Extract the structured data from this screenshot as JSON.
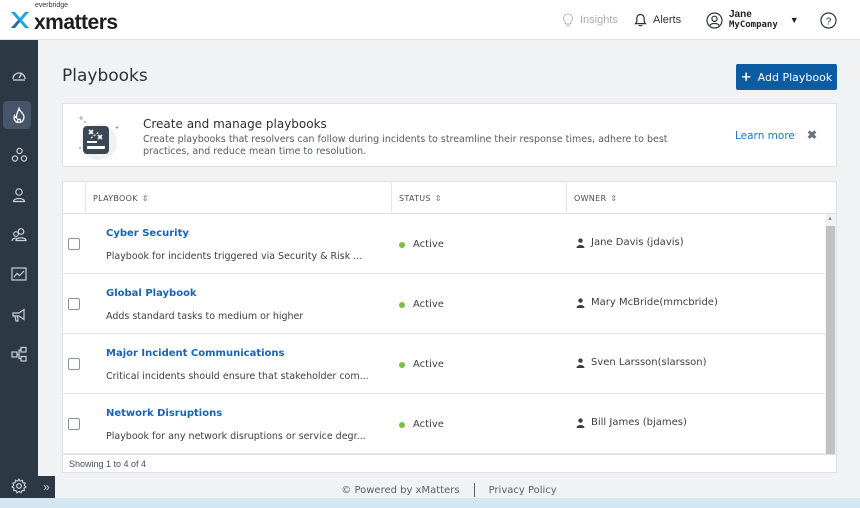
{
  "brand": {
    "small": "everbridge",
    "name": "xmatters",
    "mark_color": "#20a4dd"
  },
  "header": {
    "insights_label": "Insights",
    "alerts_label": "Alerts",
    "user_name": "Jane",
    "user_company": "MyCompany",
    "help_label": "?"
  },
  "sidebar": {
    "items": [
      {
        "icon": "dashboard-icon"
      },
      {
        "icon": "flame-icon",
        "active": true
      },
      {
        "icon": "groups-icon"
      },
      {
        "icon": "user-icon"
      },
      {
        "icon": "users-icon"
      },
      {
        "icon": "reports-icon"
      },
      {
        "icon": "megaphone-icon"
      },
      {
        "icon": "workflows-icon"
      }
    ],
    "settings_icon": "gear-icon",
    "expand_label": "»"
  },
  "page": {
    "title": "Playbooks",
    "add_button_label": "Add Playbook",
    "add_button_plus": "+"
  },
  "banner": {
    "title": "Create and manage playbooks",
    "description": "Create playbooks that resolvers can follow during incidents to streamline their response times, adhere to best practices, and reduce mean time to resolution.",
    "learn_more": "Learn more",
    "close": "✖"
  },
  "table": {
    "columns": {
      "playbook": "PLAYBOOK",
      "status": "STATUS",
      "owner": "OWNER",
      "sort": "⇕"
    },
    "rows": [
      {
        "name": "Cyber Security",
        "description": "Playbook for incidents triggered via Security & Risk ...",
        "status": "Active",
        "owner": "Jane Davis (jdavis)"
      },
      {
        "name": "Global Playbook",
        "description": "Adds standard tasks to medium or higher",
        "status": "Active",
        "owner": "Mary McBride(mmcbride)"
      },
      {
        "name": "Major Incident Communications",
        "description": "Critical incidents should ensure that stakeholder com...",
        "status": "Active",
        "owner": "Sven Larsson(slarsson)"
      },
      {
        "name": "Network Disruptions",
        "description": "Playbook for any network disruptions or service degr...",
        "status": "Active",
        "owner": "Bill James (bjames)"
      }
    ],
    "footer": "Showing 1 to 4 of 4",
    "status_color": "#7ac143"
  },
  "footer": {
    "powered_by": "© Powered by xMatters",
    "privacy": "Privacy Policy"
  },
  "colors": {
    "primary_button": "#0c5ca4",
    "link": "#1764b3",
    "sidebar": "#2d3845"
  }
}
